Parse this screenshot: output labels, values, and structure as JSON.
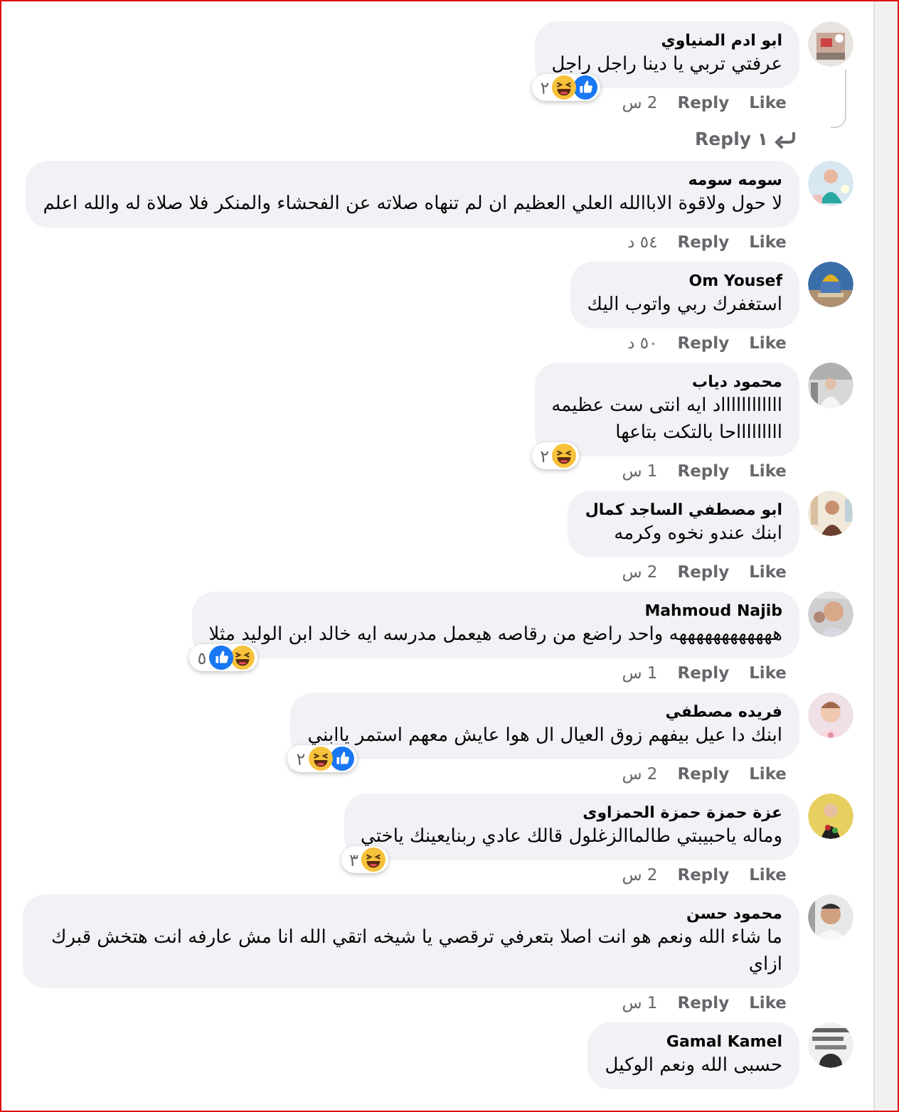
{
  "comments": [
    {
      "author": "ابو ادم المنياوي",
      "text": "عرفتي تربي يا دينا راجل راجل",
      "reactions": [
        {
          "kind": "like"
        },
        {
          "kind": "haha"
        }
      ],
      "reaction_count": "٢",
      "time": "2 س",
      "like": "Like",
      "reply": "Reply",
      "thread": true,
      "view_replies": "١ Reply"
    },
    {
      "author": "سومه سومه",
      "text": "لا حول ولاقوة الاباالله العلي العظيم ان لم تنهاه صلاته عن الفحشاء والمنكر فلا صلاة له والله اعلم",
      "time": "٥٤ د",
      "like": "Like",
      "reply": "Reply",
      "thread": false
    },
    {
      "author": "Om Yousef",
      "text": "استغفرك ربي واتوب اليك",
      "time": "٥٠ د",
      "like": "Like",
      "reply": "Reply",
      "thread": false
    },
    {
      "author": "محمود دياب",
      "text": "ااااااااااااد ايه انتى ست عظيمه\nاااااااااحا بالتكت بتاعها",
      "reactions": [
        {
          "kind": "haha"
        }
      ],
      "reaction_count": "٢",
      "time": "1 س",
      "like": "Like",
      "reply": "Reply",
      "thread": false
    },
    {
      "author": "ابو مصطفي الساجد كمال",
      "text": "ابنك عندو نخوه وكرمه",
      "time": "2 س",
      "like": "Like",
      "reply": "Reply",
      "thread": false
    },
    {
      "author": "Mahmoud Najib",
      "text": "ههههههههههههه واحد راضع من رقاصه هيعمل مدرسه ايه خالد ابن الوليد مثلا",
      "reactions": [
        {
          "kind": "haha"
        },
        {
          "kind": "like"
        }
      ],
      "reaction_count": "٥",
      "time": "1 س",
      "like": "Like",
      "reply": "Reply",
      "thread": false
    },
    {
      "author": "فريده مصطفي",
      "text": "ابنك دا عيل بيفهم زوق العيال ال هوا عايش معهم استمر ياابني",
      "reactions": [
        {
          "kind": "like"
        },
        {
          "kind": "haha"
        }
      ],
      "reaction_count": "٢",
      "time": "2 س",
      "like": "Like",
      "reply": "Reply",
      "thread": false
    },
    {
      "author": "عزة حمزة حمزة الحمزاوى",
      "text": "وماله ياحبيبتي طالماالزغلول قالك عادي ربنايعينك ياختي",
      "reactions": [
        {
          "kind": "haha"
        }
      ],
      "reaction_count": "٣",
      "time": "2 س",
      "like": "Like",
      "reply": "Reply",
      "thread": false
    },
    {
      "author": "محمود حسن",
      "text": "ما شاء الله ونعم هو انت اصلا بتعرفي ترقصي يا شيخه اتقي الله انا مش عارفه انت هتخش قبرك ازاي",
      "time": "1 س",
      "like": "Like",
      "reply": "Reply",
      "thread": false
    },
    {
      "author": "Gamal Kamel",
      "text": "حسبى الله ونعم الوكيل",
      "thread": false
    }
  ]
}
